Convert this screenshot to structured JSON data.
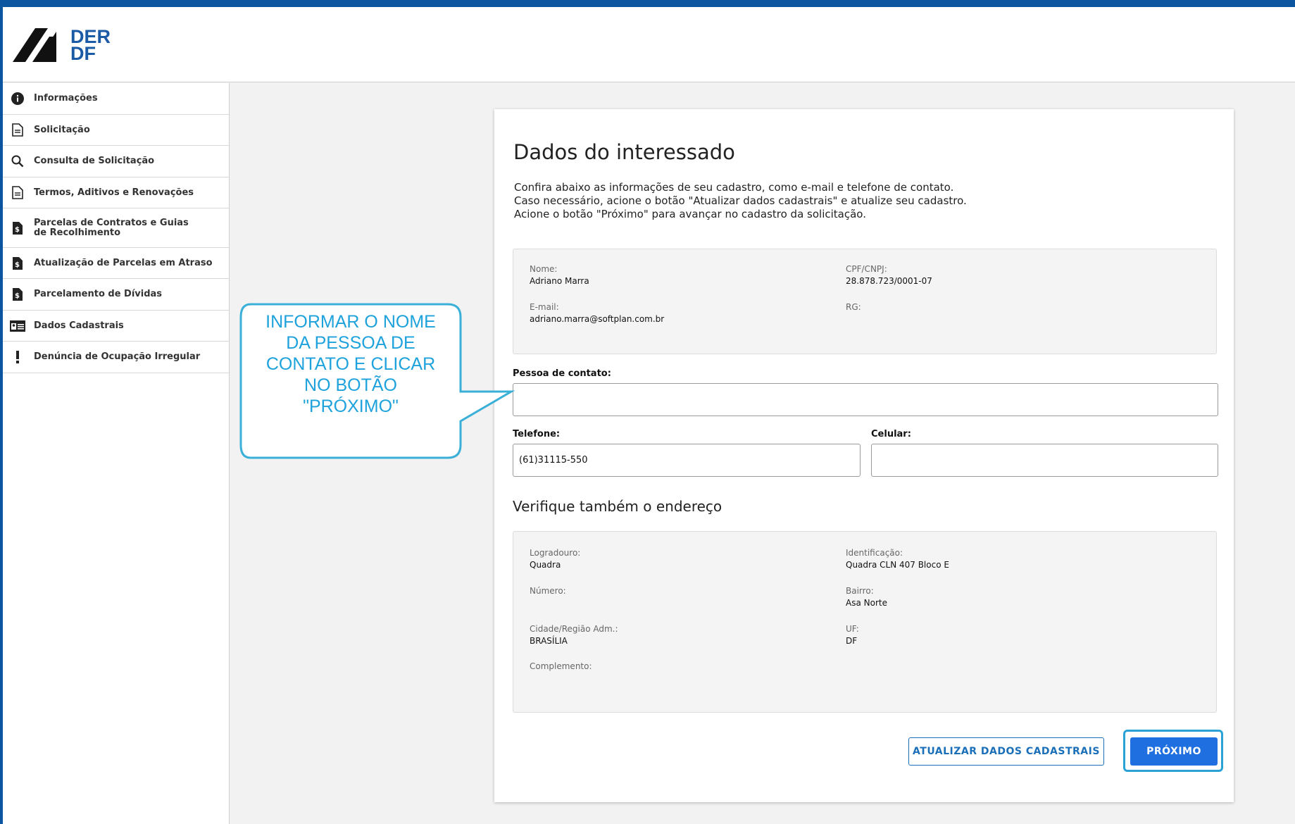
{
  "brand": {
    "line1": "DER",
    "line2": "DF"
  },
  "sidebar": {
    "items": [
      {
        "label": "Informações",
        "icon": "info-icon"
      },
      {
        "label": "Solicitação",
        "icon": "document-icon"
      },
      {
        "label": "Consulta de Solicitação",
        "icon": "search-icon"
      },
      {
        "label": "Termos, Aditivos e Renovações",
        "icon": "document-icon"
      },
      {
        "label": "Parcelas de Contratos e Guias de Recolhimento",
        "icon": "money-file-icon"
      },
      {
        "label": "Atualização de Parcelas em Atraso",
        "icon": "money-file-icon"
      },
      {
        "label": "Parcelamento de Dívidas",
        "icon": "money-file-icon"
      },
      {
        "label": "Dados Cadastrais",
        "icon": "id-card-icon"
      },
      {
        "label": "Denúncia de Ocupação Irregular",
        "icon": "exclamation-icon"
      }
    ]
  },
  "main": {
    "title": "Dados do interessado",
    "intro": [
      "Confira abaixo as informações de seu cadastro, como e-mail e telefone de contato.",
      "Caso necessário, acione o botão \"Atualizar dados cadastrais\" e atualize seu cadastro.",
      "Acione o botão \"Próximo\" para avançar no cadastro da solicitação."
    ],
    "person": {
      "nome_label": "Nome:",
      "nome": "Adriano Marra",
      "cpf_label": "CPF/CNPJ:",
      "cpf": "28.878.723/0001-07",
      "email_label": "E-mail:",
      "email": "adriano.marra@softplan.com.br",
      "rg_label": "RG:",
      "rg": ""
    },
    "contact": {
      "pessoa_label": "Pessoa de contato:",
      "pessoa_value": "",
      "telefone_label": "Telefone:",
      "telefone_value": "(61)31115-550",
      "celular_label": "Celular:",
      "celular_value": ""
    },
    "address_heading": "Verifique também o endereço",
    "address": {
      "logradouro_label": "Logradouro:",
      "logradouro": "Quadra",
      "identificacao_label": "Identificação:",
      "identificacao": "Quadra CLN 407 Bloco E",
      "numero_label": "Número:",
      "numero": "",
      "bairro_label": "Bairro:",
      "bairro": "Asa Norte",
      "cidade_label": "Cidade/Região Adm.:",
      "cidade": "BRASÍLIA",
      "uf_label": "UF:",
      "uf": "DF",
      "complemento_label": "Complemento:",
      "complemento": ""
    },
    "buttons": {
      "update": "ATUALIZAR DADOS CADASTRAIS",
      "next": "PRÓXIMO"
    }
  },
  "callout": {
    "lines": [
      "INFORMAR O NOME",
      "DA PESSOA DE",
      "CONTATO E CLICAR",
      "NO BOTÃO",
      "\"PRÓXIMO\""
    ]
  },
  "colors": {
    "accent": "#1f6fe0",
    "callout": "#1ea2dc",
    "frame": "#0b55a0"
  }
}
